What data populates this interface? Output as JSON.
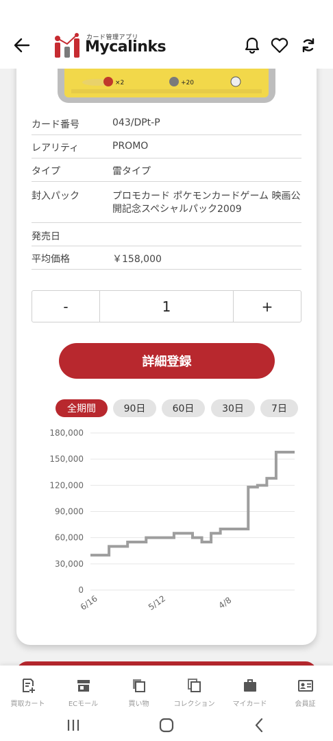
{
  "header": {
    "back_icon": "arrow-left-icon",
    "logo_subtitle": "カード管理アプリ",
    "logo_text": "Mycalinks",
    "icons": [
      "bell-icon",
      "heart-icon",
      "sync-icon"
    ]
  },
  "details": [
    {
      "label": "カード番号",
      "value": "043/DPt-P"
    },
    {
      "label": "レアリティ",
      "value": "PROMO"
    },
    {
      "label": "タイプ",
      "value": "雷タイプ"
    },
    {
      "label": "封入パック",
      "value": "プロモカード ポケモンカードゲーム 映画公開記念スペシャルパック2009"
    },
    {
      "label": "発売日",
      "value": ""
    },
    {
      "label": "平均価格",
      "value": "￥158,000"
    }
  ],
  "quantity": {
    "minus": "-",
    "value": "1",
    "plus": "+"
  },
  "register_button": "詳細登録",
  "period_tabs": [
    {
      "label": "全期間",
      "active": true
    },
    {
      "label": "90日",
      "active": false
    },
    {
      "label": "60日",
      "active": false
    },
    {
      "label": "30日",
      "active": false
    },
    {
      "label": "7日",
      "active": false
    }
  ],
  "chart_data": {
    "type": "line",
    "y_ticks": [
      "180,000",
      "150,000",
      "120,000",
      "90,000",
      "60,000",
      "30,000",
      "0"
    ],
    "x_ticks": [
      "6/16",
      "5/12",
      "4/8"
    ],
    "ylim": [
      0,
      180000
    ],
    "grid": true,
    "line_color": "#9e9e9e",
    "series": [
      {
        "values": [
          40000,
          40000,
          50000,
          50000,
          55000,
          55000,
          60000,
          60000,
          60000,
          65000,
          65000,
          60000,
          55000,
          65000,
          70000,
          70000,
          70000,
          118000,
          120000,
          128000,
          158000,
          158000,
          158000
        ]
      }
    ]
  },
  "bottom_nav": [
    {
      "label": "買取カート",
      "icon": "add-note-icon"
    },
    {
      "label": "ECモール",
      "icon": "store-icon"
    },
    {
      "label": "買い物",
      "icon": "cards-icon"
    },
    {
      "label": "コレクション",
      "icon": "collection-icon"
    },
    {
      "label": "マイカード",
      "icon": "briefcase-icon"
    },
    {
      "label": "会員証",
      "icon": "member-card-icon"
    }
  ],
  "system_nav": [
    "recents-icon",
    "home-icon",
    "back-chevron-icon"
  ],
  "colors": {
    "accent": "#b8282e",
    "chart_line": "#9e9e9e"
  }
}
